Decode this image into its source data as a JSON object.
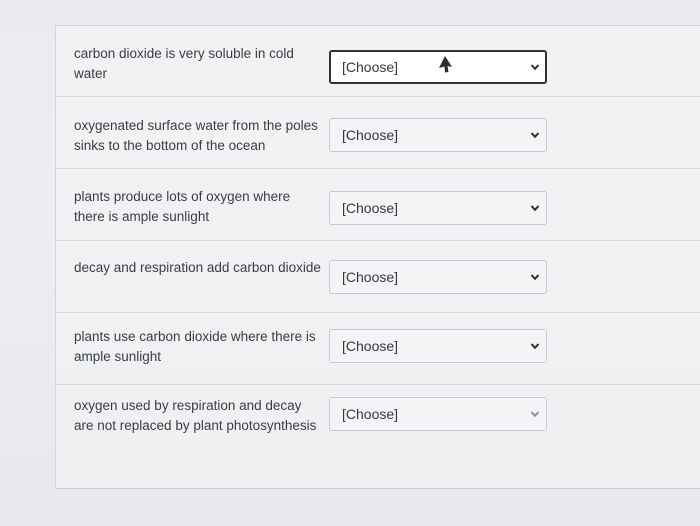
{
  "questions": [
    {
      "text": "carbon dioxide is very soluble in cold water",
      "select": "[Choose]"
    },
    {
      "text": "oxygenated surface water from the poles sinks to the bottom of the ocean",
      "select": "[Choose]"
    },
    {
      "text": "plants produce lots of oxygen where there is ample sunlight",
      "select": "[Choose]"
    },
    {
      "text": "decay and respiration add carbon dioxide",
      "select": "[Choose]"
    },
    {
      "text": "plants use carbon dioxide where there is ample sunlight",
      "select": "[Choose]"
    },
    {
      "text": "oxygen used by respiration and decay are not replaced by plant photosynthesis",
      "select": "[Choose]"
    }
  ],
  "icons": {
    "dropdown": "chevron-down-icon",
    "pointer": "mouse-pointer-icon"
  }
}
